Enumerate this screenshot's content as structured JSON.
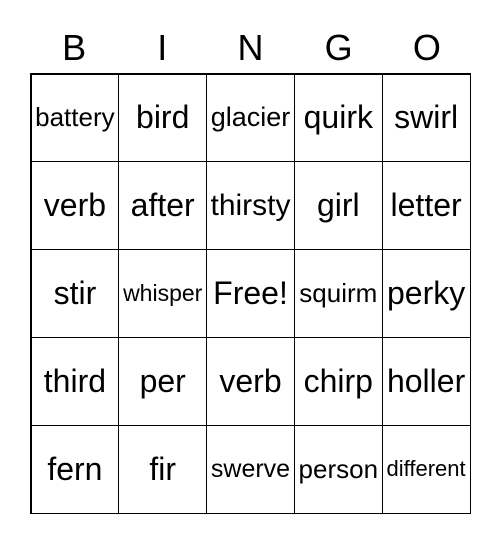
{
  "header": [
    "B",
    "I",
    "N",
    "G",
    "O"
  ],
  "cells": [
    [
      "battery",
      "bird",
      "glacier",
      "quirk",
      "swirl"
    ],
    [
      "verb",
      "after",
      "thirsty",
      "girl",
      "letter"
    ],
    [
      "stir",
      "whisper",
      "Free!",
      "squirm",
      "perky"
    ],
    [
      "third",
      "per",
      "verb",
      "chirp",
      "holler"
    ],
    [
      "fern",
      "fir",
      "swerve",
      "person",
      "different"
    ]
  ]
}
